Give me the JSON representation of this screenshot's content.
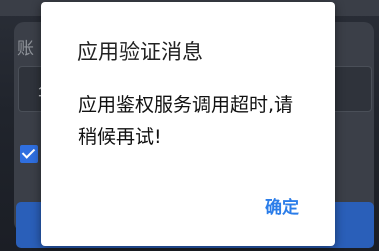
{
  "dialog": {
    "title": "应用验证消息",
    "message": "应用鉴权服务调用超时,请稍候再试!",
    "confirm_label": "确定"
  },
  "background": {
    "field_label_fragment": "账",
    "input_text_fragment": "华",
    "remember_checked": true
  },
  "colors": {
    "accent": "#2b7de9",
    "dialog_background": "#ffffff",
    "overlay_background": "#20242c"
  }
}
